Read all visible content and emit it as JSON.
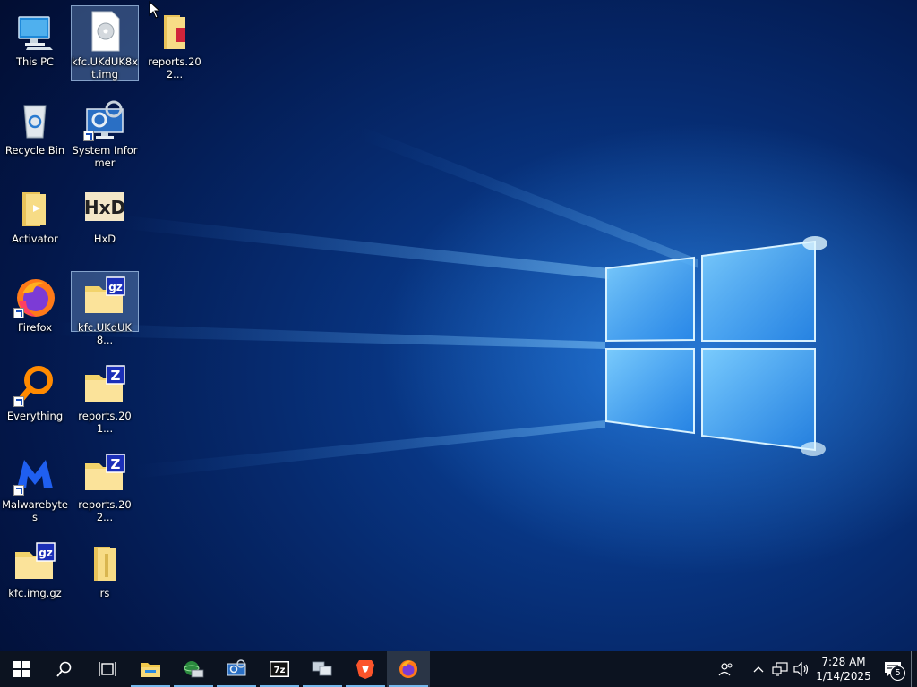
{
  "desktop": {
    "icons": [
      {
        "label": "This PC"
      },
      {
        "label": "Recycle Bin"
      },
      {
        "label": "Activator"
      },
      {
        "label": "Firefox"
      },
      {
        "label": "Everything"
      },
      {
        "label": "Malwarebytes"
      },
      {
        "label": "kfc.img.gz"
      },
      {
        "label": "kfc.UKdUK8xt.img"
      },
      {
        "label": "System Informer"
      },
      {
        "label": "HxD"
      },
      {
        "label": "kfc.UKdUK8..."
      },
      {
        "label": "reports.201..."
      },
      {
        "label": "reports.202..."
      },
      {
        "label": "rs"
      },
      {
        "label": "reports.202..."
      }
    ]
  },
  "taskbar": {
    "clock_time": "7:28 AM",
    "clock_date": "1/14/2025",
    "notification_count": "5",
    "sevenzip_label": "7z",
    "gz_badge": "gz",
    "z_badge": "Z",
    "hxd_glyph": "HxD"
  },
  "colors": {
    "taskbar_bg": "#0c1320",
    "running_indicator": "#76b9ed",
    "selection": "#78a0d2"
  }
}
